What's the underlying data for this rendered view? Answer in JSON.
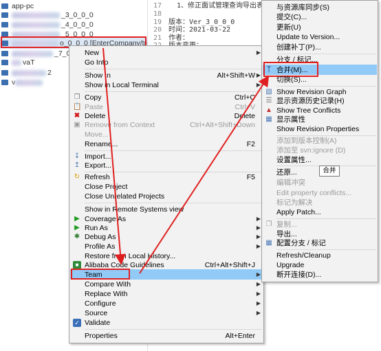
{
  "tree": {
    "rows": [
      {
        "suffix": "app-pc"
      },
      {
        "suffix": "_3_0_0_0"
      },
      {
        "suffix": "_4_0_0_0"
      },
      {
        "suffix": "_5_0_0_0"
      },
      {
        "suffix": "o_0_0_0 [EnterCompany/trun"
      },
      {
        "suffix": "_7_0_"
      },
      {
        "suffix": "vaT"
      },
      {
        "suffix": "2"
      },
      {
        "suffix": "v"
      }
    ]
  },
  "editor": {
    "lines": [
      {
        "num": "17",
        "text": "  1、修正面试管理查询导出表"
      },
      {
        "num": "18",
        "text": ""
      },
      {
        "num": "19",
        "text": "版本：Ver_3_0_0_0"
      },
      {
        "num": "20",
        "text": "时间：2021-03-22"
      },
      {
        "num": "21",
        "text": "作者："
      },
      {
        "num": "22",
        "text": "版本变更："
      }
    ]
  },
  "menu": {
    "new": "New",
    "go_into": "Go Into",
    "show_in": "Show In",
    "show_in_sc": "Alt+Shift+W",
    "show_local_terminal": "Show in Local Terminal",
    "copy": "Copy",
    "copy_sc": "Ctrl+C",
    "paste": "Paste",
    "paste_sc": "Ctrl+V",
    "delete": "Delete",
    "delete_sc": "Delete",
    "remove_context": "Remove from Context",
    "remove_context_sc": "Ctrl+Alt+Shift+Down",
    "move": "Move...",
    "rename": "Rename...",
    "rename_sc": "F2",
    "import": "Import...",
    "export": "Export...",
    "refresh": "Refresh",
    "refresh_sc": "F5",
    "close_project": "Close Project",
    "close_unrelated": "Close Unrelated Projects",
    "show_remote": "Show in Remote Systems view",
    "coverage_as": "Coverage As",
    "run_as": "Run As",
    "debug_as": "Debug As",
    "profile_as": "Profile As",
    "restore_history": "Restore from Local History...",
    "alibaba": "Alibaba Code Guidelines",
    "alibaba_sc": "Ctrl+Alt+Shift+J",
    "team": "Team",
    "compare_with": "Compare With",
    "replace_with": "Replace With",
    "configure": "Configure",
    "source": "Source",
    "validate": "Validate",
    "properties": "Properties",
    "properties_sc": "Alt+Enter"
  },
  "submenu": {
    "sync": "与资源库同步(S)",
    "commit": "提交(C)...",
    "update": "更新(U)",
    "update_version": "Update to Version...",
    "create_patch": "创建补丁(P)...",
    "branch_tag": "分支 / 标记...",
    "merge": "合并(M)...",
    "switch": "切换(S)...",
    "revision_graph": "Show Revision Graph",
    "history": "显示资源历史记录(H)",
    "tree_conflicts": "Show Tree Conflicts",
    "show_props": "显示属性",
    "revision_props": "Show Revision Properties",
    "add_vc": "添加到版本控制(A)",
    "add_ignore": "添加至 svn:ignore (D)",
    "set_props": "设置属性...",
    "revert": "还原...",
    "edit_conflicts": "编辑冲突",
    "edit_prop_conflicts": "Edit property conflicts...",
    "mark_resolved": "标记为解决",
    "apply_patch": "Apply Patch...",
    "copy": "复制...",
    "export": "导出...",
    "config_branch": "配置分支 / 标记",
    "refresh_cleanup": "Refresh/Cleanup",
    "upgrade": "Upgrade",
    "disconnect": "断开连接(D)..."
  },
  "tooltip": "合并",
  "colors": {
    "highlight": "#91c9f7",
    "annotation": "#e02020",
    "menu_bg": "#f2f2f2"
  }
}
